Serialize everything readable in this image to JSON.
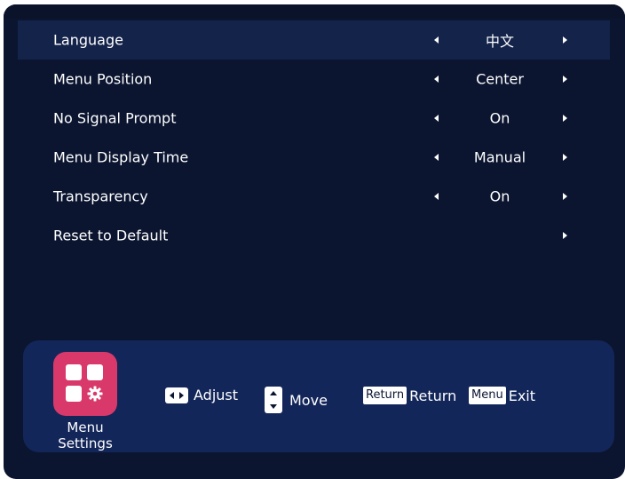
{
  "menu": {
    "items": [
      {
        "label": "Language",
        "value": "中文",
        "has_value": true,
        "selected": true
      },
      {
        "label": "Menu Position",
        "value": "Center",
        "has_value": true,
        "selected": false
      },
      {
        "label": "No Signal Prompt",
        "value": "On",
        "has_value": true,
        "selected": false
      },
      {
        "label": "Menu Display Time",
        "value": "Manual",
        "has_value": true,
        "selected": false
      },
      {
        "label": "Transparency",
        "value": "On",
        "has_value": true,
        "selected": false
      },
      {
        "label": "Reset to Default",
        "value": "",
        "has_value": false,
        "selected": false
      }
    ]
  },
  "footer": {
    "app_caption_line1": "Menu",
    "app_caption_line2": "Settings",
    "adjust_label": "Adjust",
    "move_label": "Move",
    "return_key": "Return",
    "return_label": "Return",
    "menu_key": "Menu",
    "exit_label": "Exit"
  },
  "colors": {
    "background": "#0b1530",
    "selected_row": "#14234a",
    "footer": "#13265a",
    "app_icon": "#d8386a"
  }
}
